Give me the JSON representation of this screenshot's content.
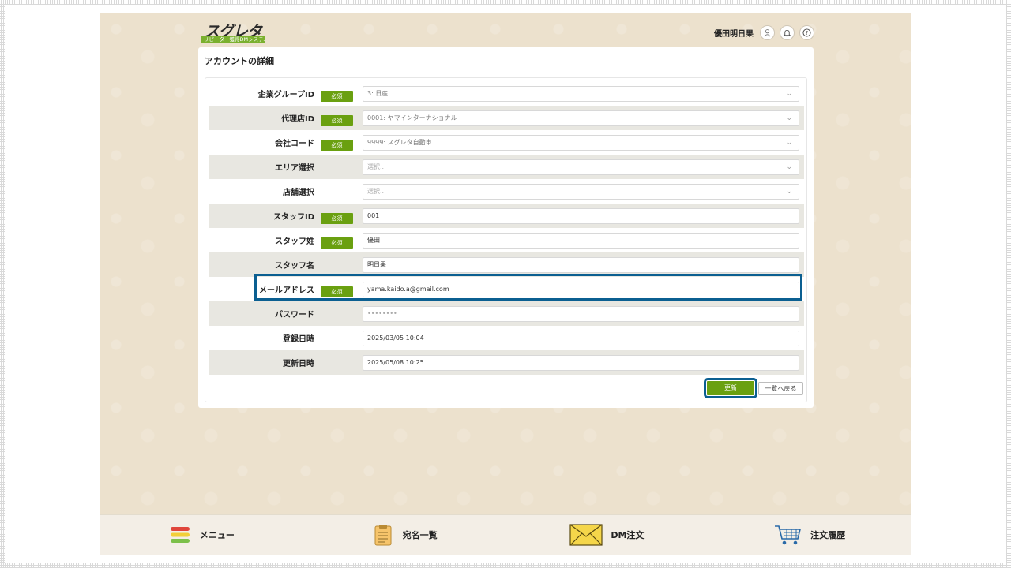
{
  "header": {
    "logo_main": "スグレタ",
    "logo_sub": "リピーター獲得DMシステム",
    "user_name": "優田明日果"
  },
  "card": {
    "title": "アカウントの詳細"
  },
  "form": {
    "required_label": "必須",
    "rows": [
      {
        "label": "企業グループID",
        "value": "3: 日産",
        "required": true
      },
      {
        "label": "代理店ID",
        "value": "0001: ヤマインターナショナル",
        "required": true
      },
      {
        "label": "会社コード",
        "value": "9999: スグレタ自動車",
        "required": true
      },
      {
        "label": "エリア選択",
        "placeholder": "選択...",
        "required": false
      },
      {
        "label": "店舗選択",
        "placeholder": "選択...",
        "required": false
      },
      {
        "label": "スタッフID",
        "value": "001",
        "required": true
      },
      {
        "label": "スタッフ姓",
        "value": "優田",
        "required": true
      },
      {
        "label": "スタッフ名",
        "value": "明日果",
        "required": false
      },
      {
        "label": "メールアドレス",
        "value": "yama.kaido.a@gmail.com",
        "required": true
      },
      {
        "label": "パスワード",
        "value": "••••••••",
        "required": false
      },
      {
        "label": "登録日時",
        "value": "2025/03/05 10:04",
        "required": false
      },
      {
        "label": "更新日時",
        "value": "2025/05/08 10:25",
        "required": false
      }
    ],
    "update_button": "更新",
    "back_button": "一覧へ戻る"
  },
  "nav": {
    "items": [
      {
        "label": "メニュー"
      },
      {
        "label": "宛名一覧"
      },
      {
        "label": "DM注文"
      },
      {
        "label": "注文履歴"
      }
    ]
  },
  "colors": {
    "accent_green": "#6aa010",
    "highlight_blue": "#0b5f91",
    "background": "#ece1cd"
  }
}
